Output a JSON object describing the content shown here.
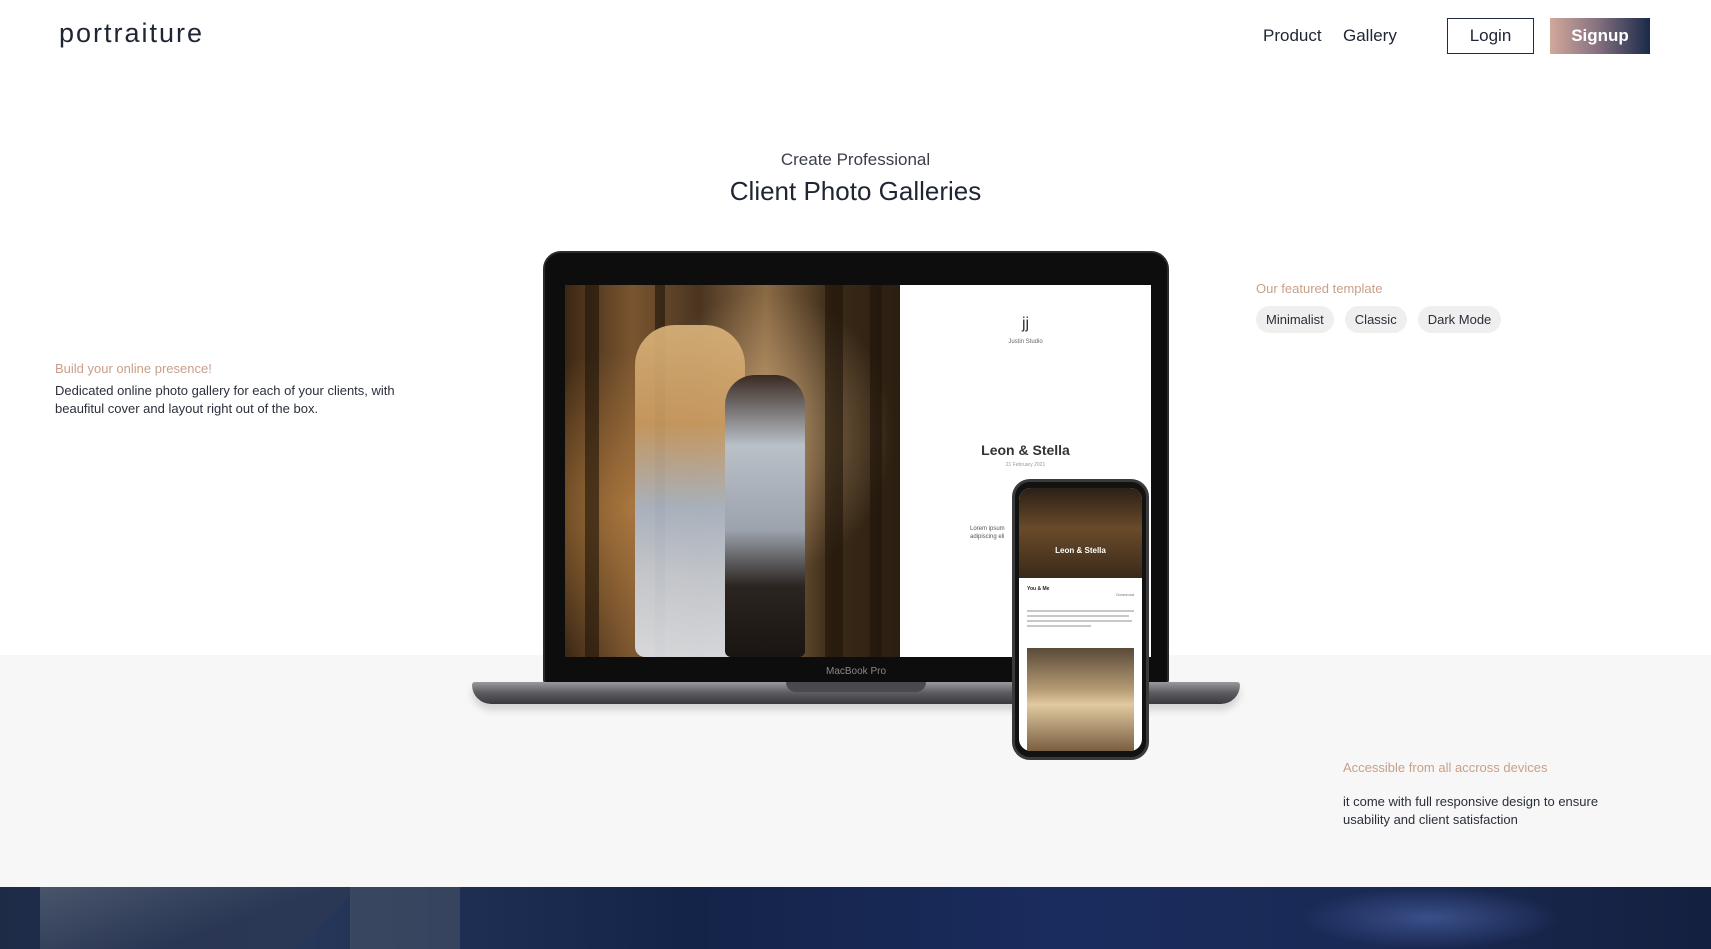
{
  "header": {
    "logo": "portraiture",
    "nav": [
      "Product",
      "Gallery"
    ],
    "login_label": "Login",
    "signup_label": "Signup"
  },
  "hero": {
    "subtitle": "Create Professional",
    "title": "Client Photo Galleries"
  },
  "left_feature": {
    "heading": "Build your online presence!",
    "text": "Dedicated online photo gallery for each of your clients, with beaufitul cover and layout right out of the box."
  },
  "featured": {
    "heading": "Our featured template",
    "tags": [
      "Minimalist",
      "Classic",
      "Dark Mode"
    ]
  },
  "bottom_feature": {
    "heading": "Accessible from all accross devices",
    "text": "it come with full responsive design to ensure usability and client satisfaction"
  },
  "mockup": {
    "laptop_label": "MacBook Pro",
    "template_logo": "jj",
    "template_studio": "Justin Studio",
    "template_names": "Leon & Stella",
    "template_date": "21 February 2021",
    "template_lorem": "Lorem ipsum adipiscing eli",
    "phone_names": "Leon & Stella",
    "phone_you_me": "You & Me",
    "phone_download": "Download"
  },
  "colors": {
    "accent": "#c8a088",
    "navy": "#1f2a44",
    "band": "#f7f7f7"
  }
}
